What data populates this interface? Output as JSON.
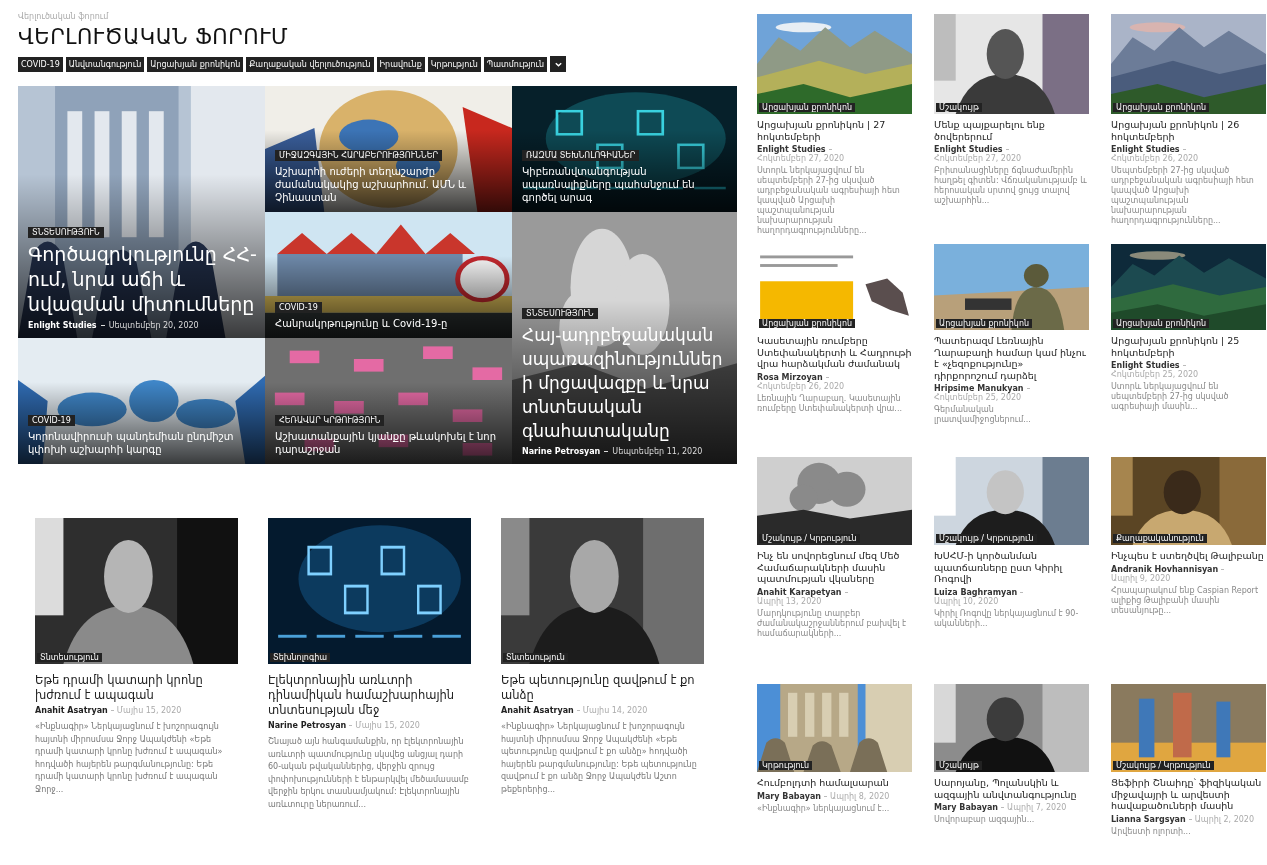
{
  "breadcrumb": "Վերլուծական ֆորում",
  "title": "ՎԵՐԼՈՒԾԱԿԱՆ ՖՈՐՈՒՄ",
  "tags": [
    "COVID-19",
    "Անվտանգություն",
    "Արցախյան քրոնիկոն",
    "Քաղաքական վերլուծություն",
    "Իրավունք",
    "Կրթություն",
    "Պատմություն"
  ],
  "featured": [
    {
      "kind": "large",
      "category": "ՏՆՏԵՍՈՒԹՅՈՒՆ",
      "title": "Գործազրկությունը ՀՀ-ում, նրա աճի և նվազման միտումները",
      "author": "Enlight Studies",
      "date": "Սեպտեմբեր 20, 2020"
    },
    {
      "kind": "small",
      "category": "ՄԻՋԱԶԳԱՅԻՆ ՀԱՐԱԲԵՐՈՒԹՅՈՒՆՆԵՐ",
      "title": "Աշխարհի ուժերի տեղաշարժը ժամանակակից աշխարհում. ԱՄՆ և Չինաստան"
    },
    {
      "kind": "small",
      "category": "ՌԱԶՄԱ ՏԵԽՆՈԼՈԳԻԱՆԵՐ",
      "title": "Կիբեռանվտանգության սպառնալիքները պահանջում են գործել արագ"
    },
    {
      "kind": "small",
      "category": "COVID-19",
      "title": "Հանրակրթությունը և Covid-19-ը"
    },
    {
      "kind": "small",
      "category": "COVID-19",
      "title": "Կորոնավիրուսի պանդեմիան ընդմիշտ կփոխի աշխարհի կարգը"
    },
    {
      "kind": "small",
      "category": "ՀԵՌԱՎԱՐ ԿՐԹՈՒԹՅՈՒՆ",
      "title": "Աշխատանքային կյանքը թևակոխել է նոր դարաշրջան"
    },
    {
      "kind": "tall",
      "category": "ՏՆՏԵՍՈՒԹՅՈՒՆ",
      "title": "Հայ-ադրբեջանական սպառազինություններ ի մրցավազքը և նրա տնտեսական գնահատականը",
      "author": "Narine Petrosyan",
      "date": "Սեպտեմբեր 11, 2020"
    }
  ],
  "cards": [
    {
      "category": "Տնտեսություն",
      "title": "Եթե դրամի կատարի կրոնը խժռում է ապագան",
      "author": "Anahit Asatryan",
      "date": "Մայիս 15, 2020",
      "excerpt": "«Ինքնագիր» Ներկայացնում է խոշորագույն հայտնի միրոսմսա Ջորջ Ապակժենի «Եթե դրամի կատարի կրոնը խժռում է ապագան» հոդվածի հայերեն թարգմանությունը: Եթե դրամի կատարի կրոնը խժռում է ապագան Ջորջ..."
    },
    {
      "category": "Տեխնոլոգիա",
      "title": "Էլեկտրոնային առևտրի դինամիկան համաշխարհային տնտեսության մեջ",
      "author": "Narine Petrosyan",
      "date": "Մայիս 15, 2020",
      "excerpt": "Շնայած այն հանգամանքին, որ էլեկտրոնային առևտրի պատմությունը սկսվեց անցյալ դարի 60-ական թվականներից, վերջին զրույց փոփոխությունների է ենթարկվել մեծամասամբ վերջին երկու տասնամյակում: Էլեկտրոնային առևտուրը ներառում..."
    },
    {
      "category": "Տնտեսություն",
      "title": "Եթե պետությունը զավթում է քո անձը",
      "author": "Anahit Asatryan",
      "date": "Մայիս 14, 2020",
      "excerpt": "«Ինքնագիր» Ներկայացնում է խոշորագույն հայտնի միրոսմսա Ջորջ Ապակժենի «Եթե պետությունը զավթում է քո անձը» հոդվածի հայերեն թարգմանությունը: Եթե պետությունը զավթում է քո անձը Ջորջ Ապակժեն Աշտո թեքերերից..."
    }
  ],
  "side_cards": [
    {
      "category": "Արցախյան քրոնիկոն",
      "title": "Արցախյան քրոնիկոն | 27 հոկտեմբերի",
      "author": "Enlight Studies",
      "date": "Հոկտեմբեր 27, 2020",
      "excerpt": "Ստորև ներկայացվում են սեպտեմբերի 27-ից սկսված ադրբեջանական ագրեսիայի հետ կապված Արցախի պաշտպանության նախարարության հաղորդագրությունները..."
    },
    {
      "category": "Մշակույթ",
      "title": "Մենք պայքարելու ենք ծովերերում",
      "author": "Enlight Studies",
      "date": "Հոկտեմբեր 27, 2020",
      "excerpt": "Բրիտանացիները ճգնաժամերին հաղթել գիտեն: Վճռականությամբ և հերոսական սրտով ցույց տալով աշխարհին..."
    },
    {
      "category": "Արցախյան քրոնիկոն",
      "title": "Արցախյան քրոնիկոն | 26 հոկտեմբերի",
      "author": "Enlight Studies",
      "date": "Հոկտեմբեր 26, 2020",
      "excerpt": "Սեպտեմբերի 27-ից սկսված ադրբեջանական ագրեսիայի հետ կապված Արցախի պաշտպանության նախարարության հաղորդագրությունները..."
    },
    {
      "category": "Արցախյան քրոնիկոն",
      "title": "Կասետային ռումբերը Ստեփանակերտի և Հադրութի վրա հարձակման ժամանակ",
      "author": "Rosa Mirzoyan",
      "date": "Հոկտեմբեր 26, 2020",
      "excerpt": "Լեռնային Ղարաբաղ. Կասետային ռումբերը Ստեփանակերտի վրա..."
    },
    {
      "category": "Արցախյան քրոնիկոն",
      "title": "Պատերազմ Լեռնային Ղարաբաղի համար կամ ինչու է «չեզոքությունը» դիրքորոշում դարձել",
      "author": "Hripsime Manukyan",
      "date": "Հոկտեմբեր 25, 2020",
      "excerpt": "Գերմանական լրատվամիջոցներում..."
    },
    {
      "category": "Արցախյան քրոնիկոն",
      "title": "Արցախյան քրոնիկոն | 25 հոկտեմբերի",
      "author": "Enlight Studies",
      "date": "Հոկտեմբեր 25, 2020",
      "excerpt": "Ստորև ներկայացվում են սեպտեմբերի 27-ից սկսված ագրեսիայի մասին..."
    },
    {
      "category": "Մշակույթ / Կրթություն",
      "title": "Ինչ են սովորեցնում մեզ Մեծ Համաճարակների մասին պատմության վկաները",
      "author": "Anahit Karapetyan",
      "date": "Ապրիլ 13, 2020",
      "excerpt": "Մարդկությունը տարբեր ժամանակաշրջաններում բախվել է համաճարակների..."
    },
    {
      "category": "Մշակույթ / Կրթություն",
      "title": "ԽՍՀՄ-ի կործանման պատճառները ըստ Կիրիլ Ռոգովի",
      "author": "Luiza Baghramyan",
      "date": "Ապրիլ 10, 2020",
      "excerpt": "Կիրիլ Ռոգովը ներկայացնում է 90-ականների..."
    },
    {
      "category": "Քաղաքականություն",
      "title": "Ինչպես է ստեղծվել Թալիբանը",
      "author": "Andranik Hovhannisyan",
      "date": "Ապրիլ 9, 2020",
      "excerpt": "Հրապարակում ենք Caspian Report ալիքից Թալիբանի մասին տեսանյութը..."
    },
    {
      "category": "Կրթություն",
      "title": "Հումբոլդտի համալսարան",
      "author": "Mary Babayan",
      "date": "Ապրիլ 8, 2020",
      "excerpt": "«Ինքնագիր» ներկայացնում է..."
    },
    {
      "category": "Մշակույթ",
      "title": "Սարոյանը, Պոլանսկին և ազգային անվտանգությունը",
      "author": "Mary Babayan",
      "date": "Ապրիլ 7, 2020",
      "excerpt": "Սովորաբար ազգային..."
    },
    {
      "category": "Մշակույթ / Կրթություն",
      "title": "Ցեֆիրի Շնաիդը՝ ֆիզիկական միջավայրի և արվեստի հավաքածուների մասին",
      "author": "Lianna Sargsyan",
      "date": "Ապրիլ 2, 2020",
      "excerpt": "Արվեստի ոլորտի..."
    }
  ]
}
